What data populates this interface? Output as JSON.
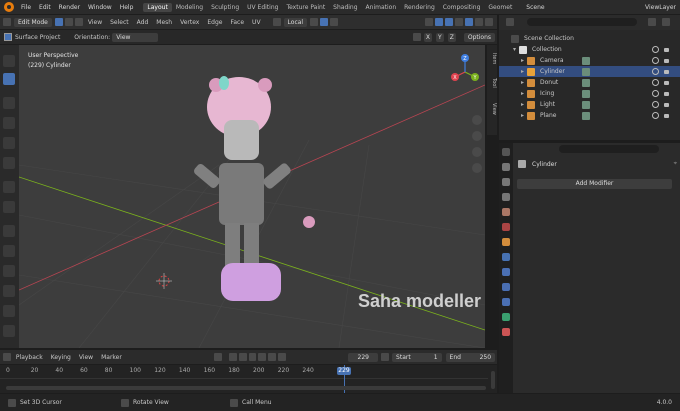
{
  "topbar": {
    "menus": [
      "File",
      "Edit",
      "Render",
      "Window",
      "Help"
    ],
    "workspaces": [
      "Layout",
      "Modeling",
      "Sculpting",
      "UV Editing",
      "Texture Paint",
      "Shading",
      "Animation",
      "Rendering",
      "Compositing",
      "Geomet"
    ],
    "active_workspace": "Layout",
    "scene_label": "Scene",
    "viewlayer_label": "ViewLayer"
  },
  "viewport_header": {
    "mode": "Edit Mode",
    "menus": [
      "View",
      "Select",
      "Add",
      "Mesh",
      "Vertex",
      "Edge",
      "Face",
      "UV"
    ],
    "orientation_global": "Local"
  },
  "viewport_header2": {
    "surface_project": "Surface Project",
    "orientation_label": "Orientation:",
    "orientation_value": "View",
    "xyz": [
      "X",
      "Y",
      "Z"
    ],
    "options": "Options"
  },
  "viewport": {
    "perspective": "User Perspective",
    "object_info": "(229) Cylinder",
    "watermark": "Saha modeller",
    "side_tabs": [
      "Item",
      "Tool",
      "View"
    ],
    "gizmo": {
      "x": "X",
      "y": "Y",
      "z": "Z"
    }
  },
  "timeline_header": {
    "menus": [
      "Playback",
      "Keying",
      "View",
      "Marker"
    ],
    "current_frame": "229",
    "start_label": "Start",
    "start_value": "1",
    "end_label": "End",
    "end_value": "250"
  },
  "timeline": {
    "ticks": [
      "0",
      "20",
      "40",
      "60",
      "80",
      "100",
      "120",
      "140",
      "160",
      "180",
      "200",
      "220",
      "240"
    ],
    "playhead": "229"
  },
  "statusbar": {
    "items": [
      "Set 3D Cursor",
      "Rotate View",
      "Call Menu"
    ],
    "version": "4.0.0"
  },
  "outliner": {
    "root": "Scene Collection",
    "collection": "Collection",
    "items": [
      {
        "name": "Camera",
        "color": "#6b8e7b",
        "selected": false
      },
      {
        "name": "Cylinder",
        "color": "#6b8e7b",
        "selected": true
      },
      {
        "name": "Donut",
        "color": "#6b8e7b",
        "selected": false
      },
      {
        "name": "Icing",
        "color": "#6b8e7b",
        "selected": false
      },
      {
        "name": "Light",
        "color": "#6b8e7b",
        "selected": false
      },
      {
        "name": "Plane",
        "color": "#6b8e7b",
        "selected": false
      }
    ]
  },
  "properties": {
    "object_name": "Cylinder",
    "add_modifier": "Add Modifier"
  },
  "colors": {
    "accent": "#4772b3",
    "axis_x": "#e0434f",
    "axis_y": "#7bb21d",
    "axis_z": "#3f7ee0",
    "orange": "#e87d0d"
  }
}
